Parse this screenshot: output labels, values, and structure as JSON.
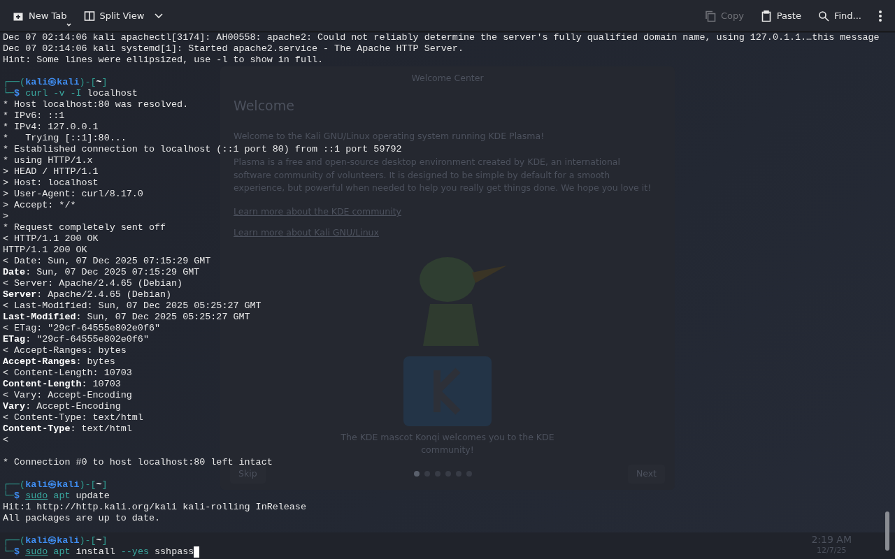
{
  "toolbar": {
    "left": [
      {
        "kind": "new-tab",
        "label": "New Tab",
        "disabled": false
      },
      {
        "kind": "split-view",
        "label": "Split View",
        "disabled": false
      }
    ],
    "right": [
      {
        "kind": "copy",
        "label": "Copy",
        "disabled": true
      },
      {
        "kind": "paste",
        "label": "Paste",
        "disabled": false
      },
      {
        "kind": "find",
        "label": "Find...",
        "disabled": false
      },
      {
        "kind": "more",
        "disabled": false
      }
    ]
  },
  "background": {
    "window_title": "Welcome Center",
    "heading": "Welcome",
    "paragraphs": [
      "Welcome to the Kali GNU/Linux operating system running KDE Plasma!",
      "Plasma is a free and open-source desktop environment created by KDE, an international software community of volunteers. It is designed to be simple by default for a smooth experience, but powerful when needed to help you really get things done. We hope you love it!"
    ],
    "links": [
      "Learn more about the KDE community",
      "Learn more about Kali GNU/Linux"
    ],
    "caption": "The KDE mascot Konqi welcomes you to the KDE community!",
    "pages": [
      {
        "selected": true
      },
      {
        "selected": false
      },
      {
        "selected": false
      },
      {
        "selected": false
      },
      {
        "selected": false
      },
      {
        "selected": false
      }
    ],
    "skip": "Skip",
    "next": "Next",
    "clock": "2:19 AM",
    "date": "12/7/25"
  },
  "terminal": {
    "cursor": true,
    "lines": [
      {
        "kind": "text",
        "segments": [
          {
            "text": "Dec 07 02:14:06 kali apachectl[3174]: AH00558: apache2: Could not reliably determine the server's fully qualified domain name, using 127.0.1.1.…this message",
            "kind": "plain"
          }
        ]
      },
      {
        "kind": "text",
        "segments": [
          {
            "text": "Dec 07 02:14:06 kali systemd[1]: Started apache2.service - The Apache HTTP Server.",
            "kind": "plain"
          }
        ]
      },
      {
        "kind": "text",
        "segments": [
          {
            "text": "Hint: Some lines were ellipsized, use -l to show in full.",
            "kind": "plain"
          }
        ]
      },
      {
        "kind": "blank"
      },
      {
        "kind": "text",
        "segments": [
          {
            "text": "┌──(",
            "kind": "frame"
          },
          {
            "text": "kali㉿kali",
            "kind": "user"
          },
          {
            "text": ")-[",
            "kind": "frame"
          },
          {
            "text": "~",
            "kind": "dir"
          },
          {
            "text": "]",
            "kind": "frame"
          }
        ]
      },
      {
        "kind": "text",
        "segments": [
          {
            "text": "└─",
            "kind": "frame"
          },
          {
            "text": "$ ",
            "kind": "dollar"
          },
          {
            "text": "curl",
            "kind": "command"
          },
          {
            "text": " -v -I ",
            "kind": "option"
          },
          {
            "text": "localhost",
            "kind": "plain"
          }
        ]
      },
      {
        "kind": "text",
        "segments": [
          {
            "text": "* Host localhost:80 was resolved.",
            "kind": "plain"
          }
        ]
      },
      {
        "kind": "text",
        "segments": [
          {
            "text": "* IPv6: ::1",
            "kind": "plain"
          }
        ]
      },
      {
        "kind": "text",
        "segments": [
          {
            "text": "* IPv4: 127.0.0.1",
            "kind": "plain"
          }
        ]
      },
      {
        "kind": "text",
        "segments": [
          {
            "text": "*   Trying [::1]:80...",
            "kind": "plain"
          }
        ]
      },
      {
        "kind": "text",
        "segments": [
          {
            "text": "* Established connection to localhost (::1 port 80) from ::1 port 59792",
            "kind": "plain"
          }
        ]
      },
      {
        "kind": "text",
        "segments": [
          {
            "text": "* using HTTP/1.x",
            "kind": "plain"
          }
        ]
      },
      {
        "kind": "text",
        "segments": [
          {
            "text": "> HEAD / HTTP/1.1",
            "kind": "plain"
          }
        ]
      },
      {
        "kind": "text",
        "segments": [
          {
            "text": "> Host: localhost",
            "kind": "plain"
          }
        ]
      },
      {
        "kind": "text",
        "segments": [
          {
            "text": "> User-Agent: curl/8.17.0",
            "kind": "plain"
          }
        ]
      },
      {
        "kind": "text",
        "segments": [
          {
            "text": "> Accept: */*",
            "kind": "plain"
          }
        ]
      },
      {
        "kind": "text",
        "segments": [
          {
            "text": ">",
            "kind": "plain"
          }
        ]
      },
      {
        "kind": "text",
        "segments": [
          {
            "text": "* Request completely sent off",
            "kind": "plain"
          }
        ]
      },
      {
        "kind": "text",
        "segments": [
          {
            "text": "< HTTP/1.1 200 OK",
            "kind": "plain"
          }
        ]
      },
      {
        "kind": "text",
        "segments": [
          {
            "text": "HTTP/1.1 200 OK",
            "kind": "plain"
          }
        ]
      },
      {
        "kind": "text",
        "segments": [
          {
            "text": "< Date: Sun, 07 Dec 2025 07:15:29 GMT",
            "kind": "plain"
          }
        ]
      },
      {
        "kind": "text",
        "segments": [
          {
            "text": "Date",
            "kind": "key"
          },
          {
            "text": ": Sun, 07 Dec 2025 07:15:29 GMT",
            "kind": "plain"
          }
        ]
      },
      {
        "kind": "text",
        "segments": [
          {
            "text": "< Server: Apache/2.4.65 (Debian)",
            "kind": "plain"
          }
        ]
      },
      {
        "kind": "text",
        "segments": [
          {
            "text": "Server",
            "kind": "key"
          },
          {
            "text": ": Apache/2.4.65 (Debian)",
            "kind": "plain"
          }
        ]
      },
      {
        "kind": "text",
        "segments": [
          {
            "text": "< Last-Modified: Sun, 07 Dec 2025 05:25:27 GMT",
            "kind": "plain"
          }
        ]
      },
      {
        "kind": "text",
        "segments": [
          {
            "text": "Last-Modified",
            "kind": "key"
          },
          {
            "text": ": Sun, 07 Dec 2025 05:25:27 GMT",
            "kind": "plain"
          }
        ]
      },
      {
        "kind": "text",
        "segments": [
          {
            "text": "< ETag: \"29cf-64555e802e0f6\"",
            "kind": "plain"
          }
        ]
      },
      {
        "kind": "text",
        "segments": [
          {
            "text": "ETag",
            "kind": "key"
          },
          {
            "text": ": \"29cf-64555e802e0f6\"",
            "kind": "plain"
          }
        ]
      },
      {
        "kind": "text",
        "segments": [
          {
            "text": "< Accept-Ranges: bytes",
            "kind": "plain"
          }
        ]
      },
      {
        "kind": "text",
        "segments": [
          {
            "text": "Accept-Ranges",
            "kind": "key"
          },
          {
            "text": ": bytes",
            "kind": "plain"
          }
        ]
      },
      {
        "kind": "text",
        "segments": [
          {
            "text": "< Content-Length: 10703",
            "kind": "plain"
          }
        ]
      },
      {
        "kind": "text",
        "segments": [
          {
            "text": "Content-Length",
            "kind": "key"
          },
          {
            "text": ": 10703",
            "kind": "plain"
          }
        ]
      },
      {
        "kind": "text",
        "segments": [
          {
            "text": "< Vary: Accept-Encoding",
            "kind": "plain"
          }
        ]
      },
      {
        "kind": "text",
        "segments": [
          {
            "text": "Vary",
            "kind": "key"
          },
          {
            "text": ": Accept-Encoding",
            "kind": "plain"
          }
        ]
      },
      {
        "kind": "text",
        "segments": [
          {
            "text": "< Content-Type: text/html",
            "kind": "plain"
          }
        ]
      },
      {
        "kind": "text",
        "segments": [
          {
            "text": "Content-Type",
            "kind": "key"
          },
          {
            "text": ": text/html",
            "kind": "plain"
          }
        ]
      },
      {
        "kind": "text",
        "segments": [
          {
            "text": "<",
            "kind": "plain"
          }
        ]
      },
      {
        "kind": "blank"
      },
      {
        "kind": "text",
        "segments": [
          {
            "text": "* Connection #0 to host localhost:80 left intact",
            "kind": "plain"
          }
        ]
      },
      {
        "kind": "blank"
      },
      {
        "kind": "text",
        "segments": [
          {
            "text": "┌──(",
            "kind": "frame"
          },
          {
            "text": "kali㉿kali",
            "kind": "user"
          },
          {
            "text": ")-[",
            "kind": "frame"
          },
          {
            "text": "~",
            "kind": "dir"
          },
          {
            "text": "]",
            "kind": "frame"
          }
        ]
      },
      {
        "kind": "text",
        "segments": [
          {
            "text": "└─",
            "kind": "frame"
          },
          {
            "text": "$ ",
            "kind": "dollar"
          },
          {
            "text": "sudo",
            "kind": "command-underlined"
          },
          {
            "text": " apt",
            "kind": "command"
          },
          {
            "text": " update",
            "kind": "plain"
          }
        ]
      },
      {
        "kind": "text",
        "segments": [
          {
            "text": "Hit:1 http://http.kali.org/kali kali-rolling InRelease",
            "kind": "plain"
          }
        ]
      },
      {
        "kind": "text",
        "segments": [
          {
            "text": "All packages are up to date.",
            "kind": "plain"
          }
        ]
      },
      {
        "kind": "blank"
      },
      {
        "kind": "text",
        "segments": [
          {
            "text": "┌──(",
            "kind": "frame"
          },
          {
            "text": "kali㉿kali",
            "kind": "user"
          },
          {
            "text": ")-[",
            "kind": "frame"
          },
          {
            "text": "~",
            "kind": "dir"
          },
          {
            "text": "]",
            "kind": "frame"
          }
        ]
      },
      {
        "kind": "text",
        "segments": [
          {
            "text": "└─",
            "kind": "frame"
          },
          {
            "text": "$ ",
            "kind": "dollar"
          },
          {
            "text": "sudo",
            "kind": "command-underlined"
          },
          {
            "text": " apt",
            "kind": "command"
          },
          {
            "text": " install ",
            "kind": "plain"
          },
          {
            "text": "--yes",
            "kind": "option"
          },
          {
            "text": " sshpass",
            "kind": "plain"
          }
        ]
      }
    ]
  }
}
